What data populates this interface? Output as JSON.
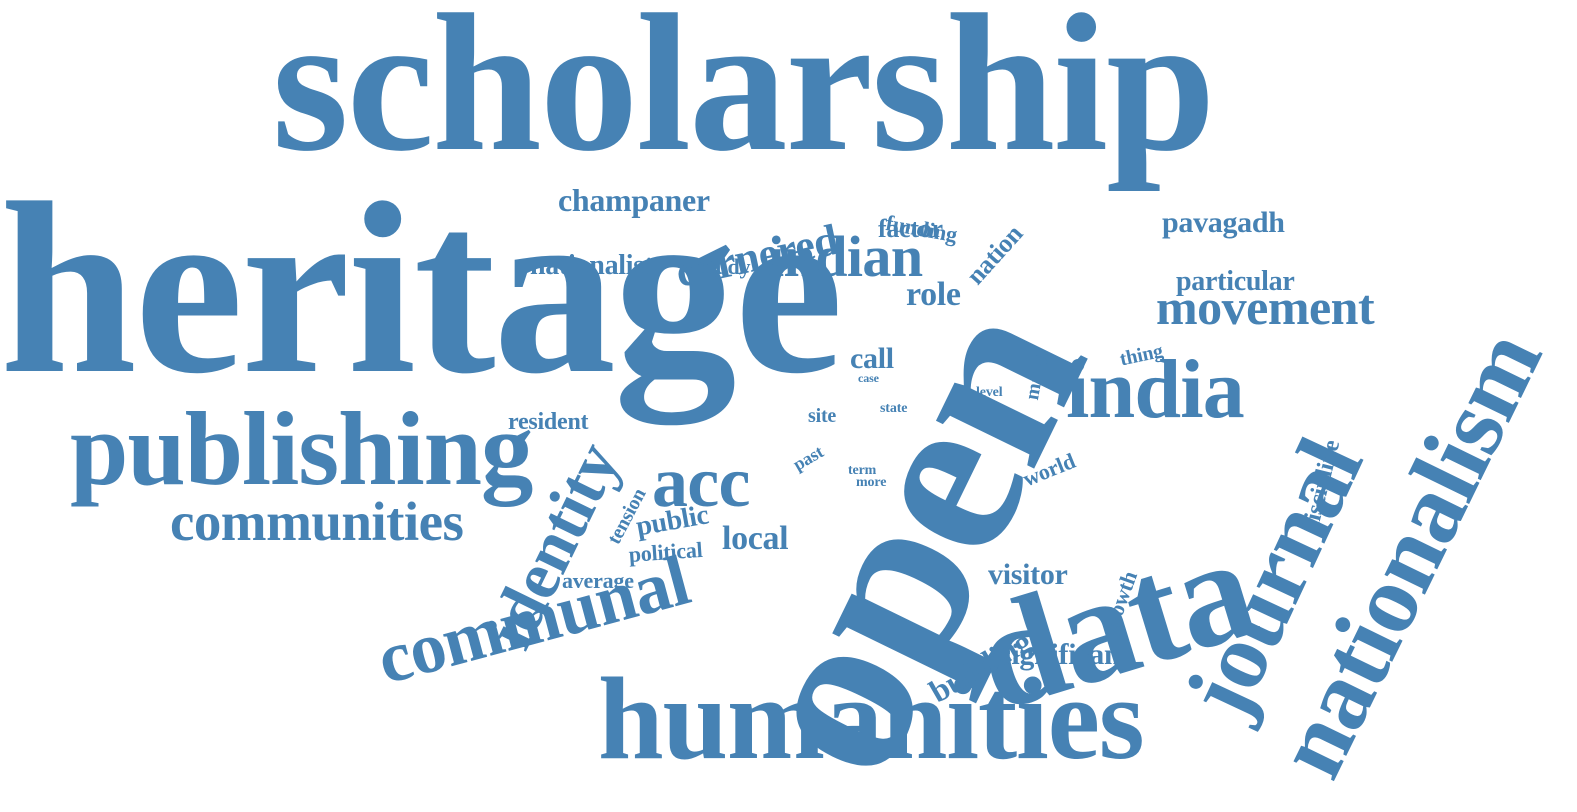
{
  "colors": {
    "word": "#4682B4",
    "background": "#FFFFFF"
  },
  "words": {
    "scholarship": "scholarship",
    "heritage": "heritage",
    "open": "open",
    "humanities": "humanities",
    "nationalism": "nationalism",
    "journal": "journal",
    "data": "data",
    "publishing": "publishing",
    "communal": "communal",
    "identity": "identity",
    "india": "india",
    "communities": "communities",
    "indian": "indian",
    "acc": "acc",
    "movement": "movement",
    "cornered": "cornered",
    "champaner": "champaner",
    "nationalist": "nationalist",
    "study": "study",
    "funding": "funding",
    "factor": "factor",
    "nation": "nation",
    "pavagadh": "pavagadh",
    "particular": "particular",
    "role": "role",
    "call": "call",
    "case": "case",
    "many": "many",
    "level": "level",
    "thing": "thing",
    "resident": "resident",
    "site": "site",
    "state": "state",
    "past": "past",
    "world": "world",
    "discipline": "discipline",
    "term": "term",
    "more": "more",
    "tension": "tension",
    "public": "public",
    "political": "political",
    "local": "local",
    "growth": "growth",
    "average": "average",
    "visitor": "visitor",
    "building": "building",
    "significant": "significant"
  }
}
